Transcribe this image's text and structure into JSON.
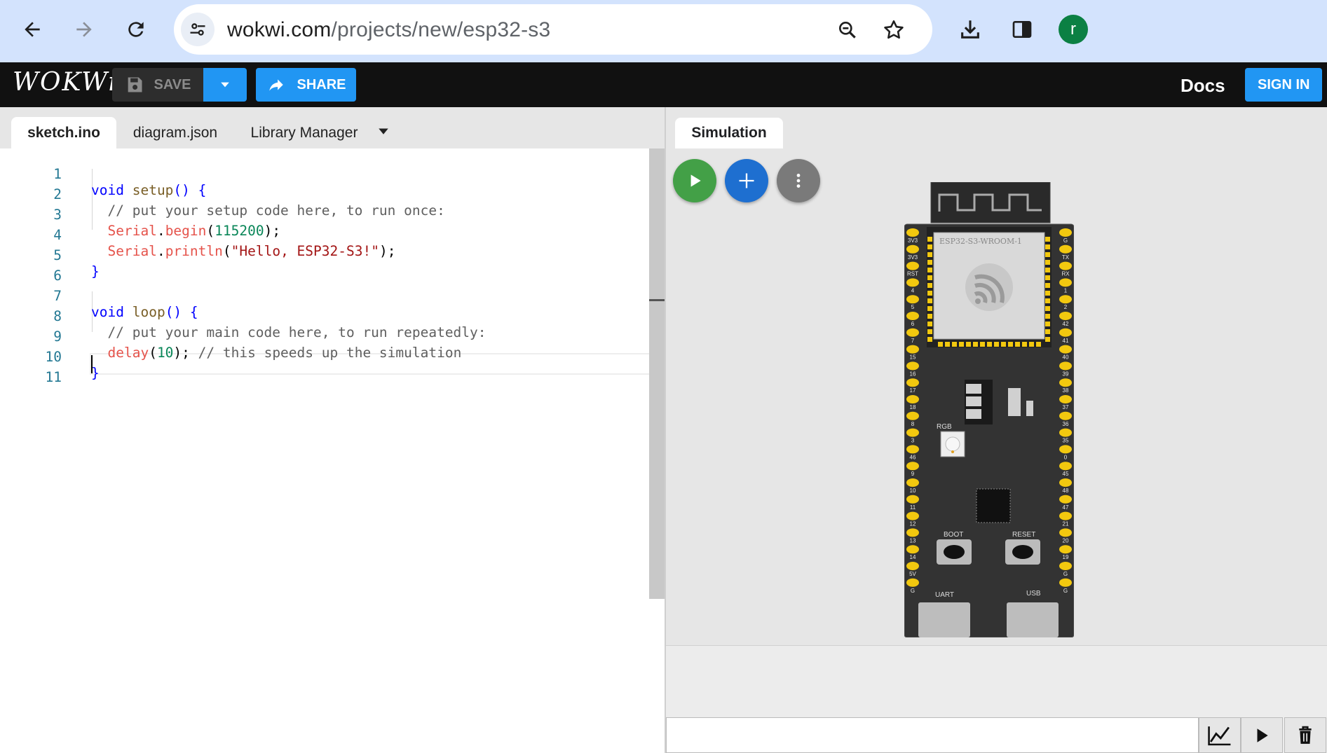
{
  "browser": {
    "url_host": "wokwi.com",
    "url_path": "/projects/new/esp32-s3",
    "avatar_letter": "r",
    "icons": [
      "back-icon",
      "forward-icon",
      "reload-icon",
      "site-settings-icon",
      "zoom-icon",
      "bookmark-star-icon",
      "download-icon",
      "side-panel-icon"
    ]
  },
  "header": {
    "logo": "WOKWi",
    "save_label": "SAVE",
    "share_label": "SHARE",
    "docs_label": "Docs",
    "signin_label": "SIGN IN",
    "accent_color": "#2196f3"
  },
  "editor": {
    "tabs": [
      {
        "label": "sketch.ino",
        "active": true
      },
      {
        "label": "diagram.json",
        "active": false
      },
      {
        "label": "Library Manager",
        "active": false
      }
    ],
    "lines": [
      {
        "n": "1",
        "text": "void setup() {"
      },
      {
        "n": "2",
        "text": "  // put your setup code here, to run once:"
      },
      {
        "n": "3",
        "text": "  Serial.begin(115200);"
      },
      {
        "n": "4",
        "text": "  Serial.println(\"Hello, ESP32-S3!\");"
      },
      {
        "n": "5",
        "text": "}"
      },
      {
        "n": "6",
        "text": ""
      },
      {
        "n": "7",
        "text": "void loop() {"
      },
      {
        "n": "8",
        "text": "  // put your main code here, to run repeatedly:"
      },
      {
        "n": "9",
        "text": "  delay(10); // this speeds up the simulation"
      },
      {
        "n": "10",
        "text": "}"
      },
      {
        "n": "11",
        "text": ""
      }
    ]
  },
  "simulation": {
    "tab_label": "Simulation",
    "board": {
      "module_label": "ESP32-S3-WROOM-1",
      "rgb_label": "RGB",
      "boot_label": "BOOT",
      "reset_label": "RESET",
      "uart_label": "UART",
      "usb_label": "USB",
      "left_pins": [
        "3V3",
        "3V3",
        "RST",
        "4",
        "5",
        "6",
        "7",
        "15",
        "16",
        "17",
        "18",
        "8",
        "3",
        "46",
        "9",
        "10",
        "11",
        "12",
        "13",
        "14",
        "5V",
        "G"
      ],
      "right_pins": [
        "G",
        "TX",
        "RX",
        "1",
        "2",
        "42",
        "41",
        "40",
        "39",
        "38",
        "37",
        "36",
        "35",
        "0",
        "45",
        "48",
        "47",
        "21",
        "20",
        "19",
        "G",
        "G"
      ]
    },
    "serial_buttons": [
      "chart-icon",
      "play-icon",
      "trash-icon"
    ]
  }
}
